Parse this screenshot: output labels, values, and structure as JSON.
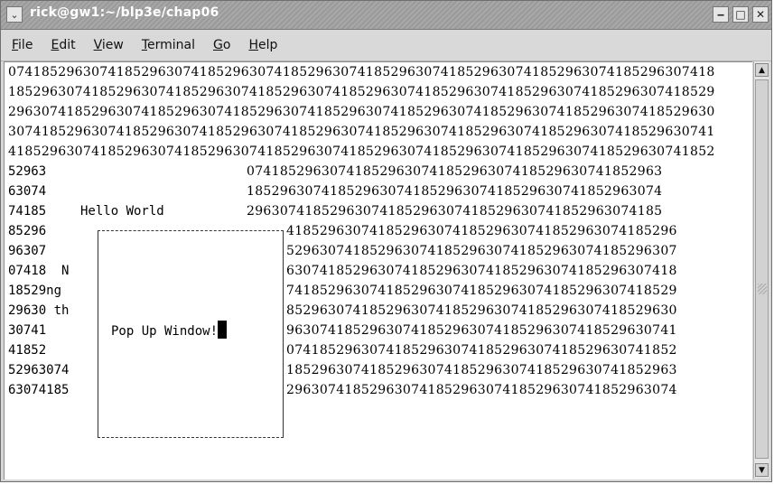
{
  "window": {
    "title": "rick@gw1:~/blp3e/chap06",
    "controls": {
      "menu_glyph": "⌄",
      "minimize_glyph": "‒",
      "maximize_glyph": "□",
      "close_glyph": "✕"
    }
  },
  "menubar": {
    "items": [
      {
        "mnemonic": "F",
        "rest": "ile"
      },
      {
        "mnemonic": "E",
        "rest": "dit"
      },
      {
        "mnemonic": "V",
        "rest": "iew"
      },
      {
        "mnemonic": "T",
        "rest": "erminal"
      },
      {
        "mnemonic": "G",
        "rest": "o"
      },
      {
        "mnemonic": "H",
        "rest": "elp"
      }
    ]
  },
  "terminal": {
    "full_rows": [
      "0741852963074185296307418529630741852963074185296307418529630741852963074185296307418",
      "1852963074185296307418529630741852963074185296307418529630741852963074185296307418529",
      "2963074185296307418529630741852963074185296307418529630741852963074185296307418529630",
      "3074185296307418529630741852963074185296307418529630741852963074185296307418529630741",
      "4185296307418529630741852963074185296307418529630741852963074185296307418529630741852"
    ],
    "rows": [
      {
        "left": "52963",
        "right": "07418529630741852963074185296307418529630741852963"
      },
      {
        "left": "63074",
        "right": "18529630741852963074185296307418529630741852963074"
      },
      {
        "left": "74185",
        "right": "29630741852963074185296307418529630741852963074185"
      },
      {
        "left": "85296",
        "right": "41852963074185296307418529630741852963074185296"
      },
      {
        "left": "96307",
        "right": "52963074185296307418529630741852963074185296307"
      },
      {
        "left": "07418  N",
        "right": "63074185296307418529630741852963074185296307418"
      },
      {
        "left": "18529ng",
        "right": "74185296307418529630741852963074185296307418529"
      },
      {
        "left": "29630 th",
        "right": "85296307418529630741852963074185296307418529630"
      },
      {
        "left": "30741",
        "right": "96307418529630741852963074185296307418529630741"
      },
      {
        "left": "41852",
        "right": "07418529630741852963074185296307418529630741852"
      },
      {
        "left": "52963074",
        "right": "18529630741852963074185296307418529630741852963"
      },
      {
        "left": "63074185",
        "right": "29630741852963074185296307418529630741852963074"
      }
    ],
    "hello_text": "Hello World",
    "popup_text": "Pop Up Window!"
  },
  "scrollbar": {
    "up_glyph": "▲",
    "down_glyph": "▼"
  }
}
